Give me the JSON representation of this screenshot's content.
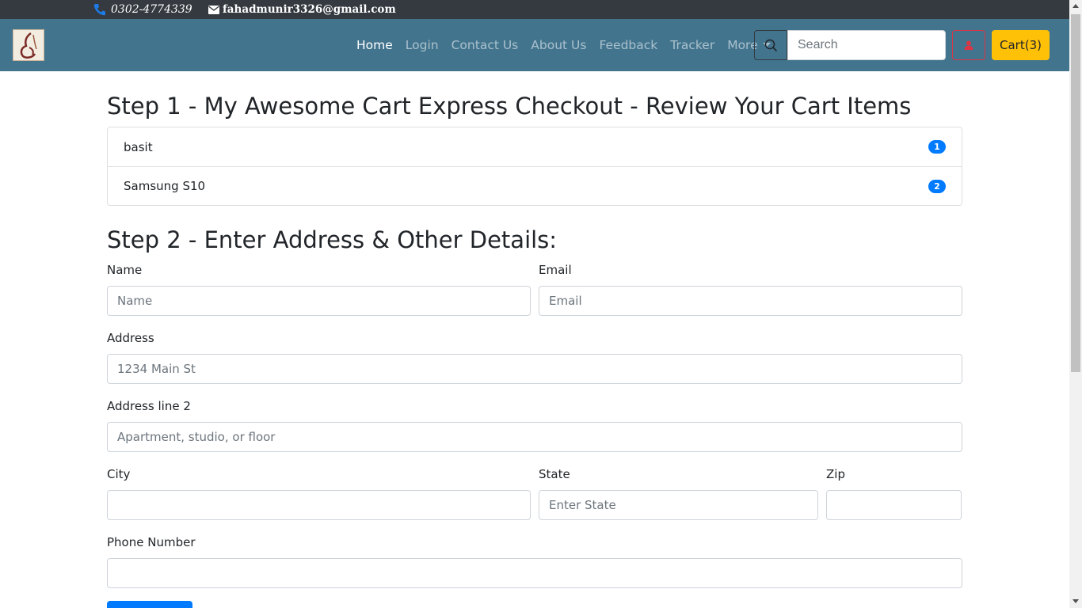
{
  "topbar": {
    "phone": "0302-4774339",
    "email": "fahadmunir3326@gmail.com",
    "phone_icon": "phone-icon",
    "email_icon": "envelope-icon"
  },
  "navbar": {
    "logo_icon": "brand-logo",
    "links": [
      "Home",
      "Login",
      "Contact Us",
      "About Us",
      "Feedback",
      "Tracker",
      "More"
    ],
    "active_link": "Home",
    "search_placeholder": "Search",
    "cart_label": "Cart(3)",
    "colors": {
      "navbar_bg": "#42748e",
      "topbar_bg": "#343a40",
      "cart_bg": "#ffc107",
      "user_btn": "#dc3545",
      "badge": "#007bff"
    }
  },
  "step1": {
    "title": "Step 1 - My Awesome Cart Express Checkout - Review Your Cart Items",
    "items": [
      {
        "name": "basit",
        "qty": "1"
      },
      {
        "name": "Samsung S10",
        "qty": "2"
      }
    ]
  },
  "step2": {
    "title": "Step 2 - Enter Address & Other Details:",
    "name_label": "Name",
    "name_placeholder": "Name",
    "email_label": "Email",
    "email_placeholder": "Email",
    "address_label": "Address",
    "address_placeholder": "1234 Main St",
    "address2_label": "Address line 2",
    "address2_placeholder": "Apartment, studio, or floor",
    "city_label": "City",
    "state_label": "State",
    "state_placeholder": "Enter State",
    "zip_label": "Zip",
    "phone_label": "Phone Number"
  }
}
